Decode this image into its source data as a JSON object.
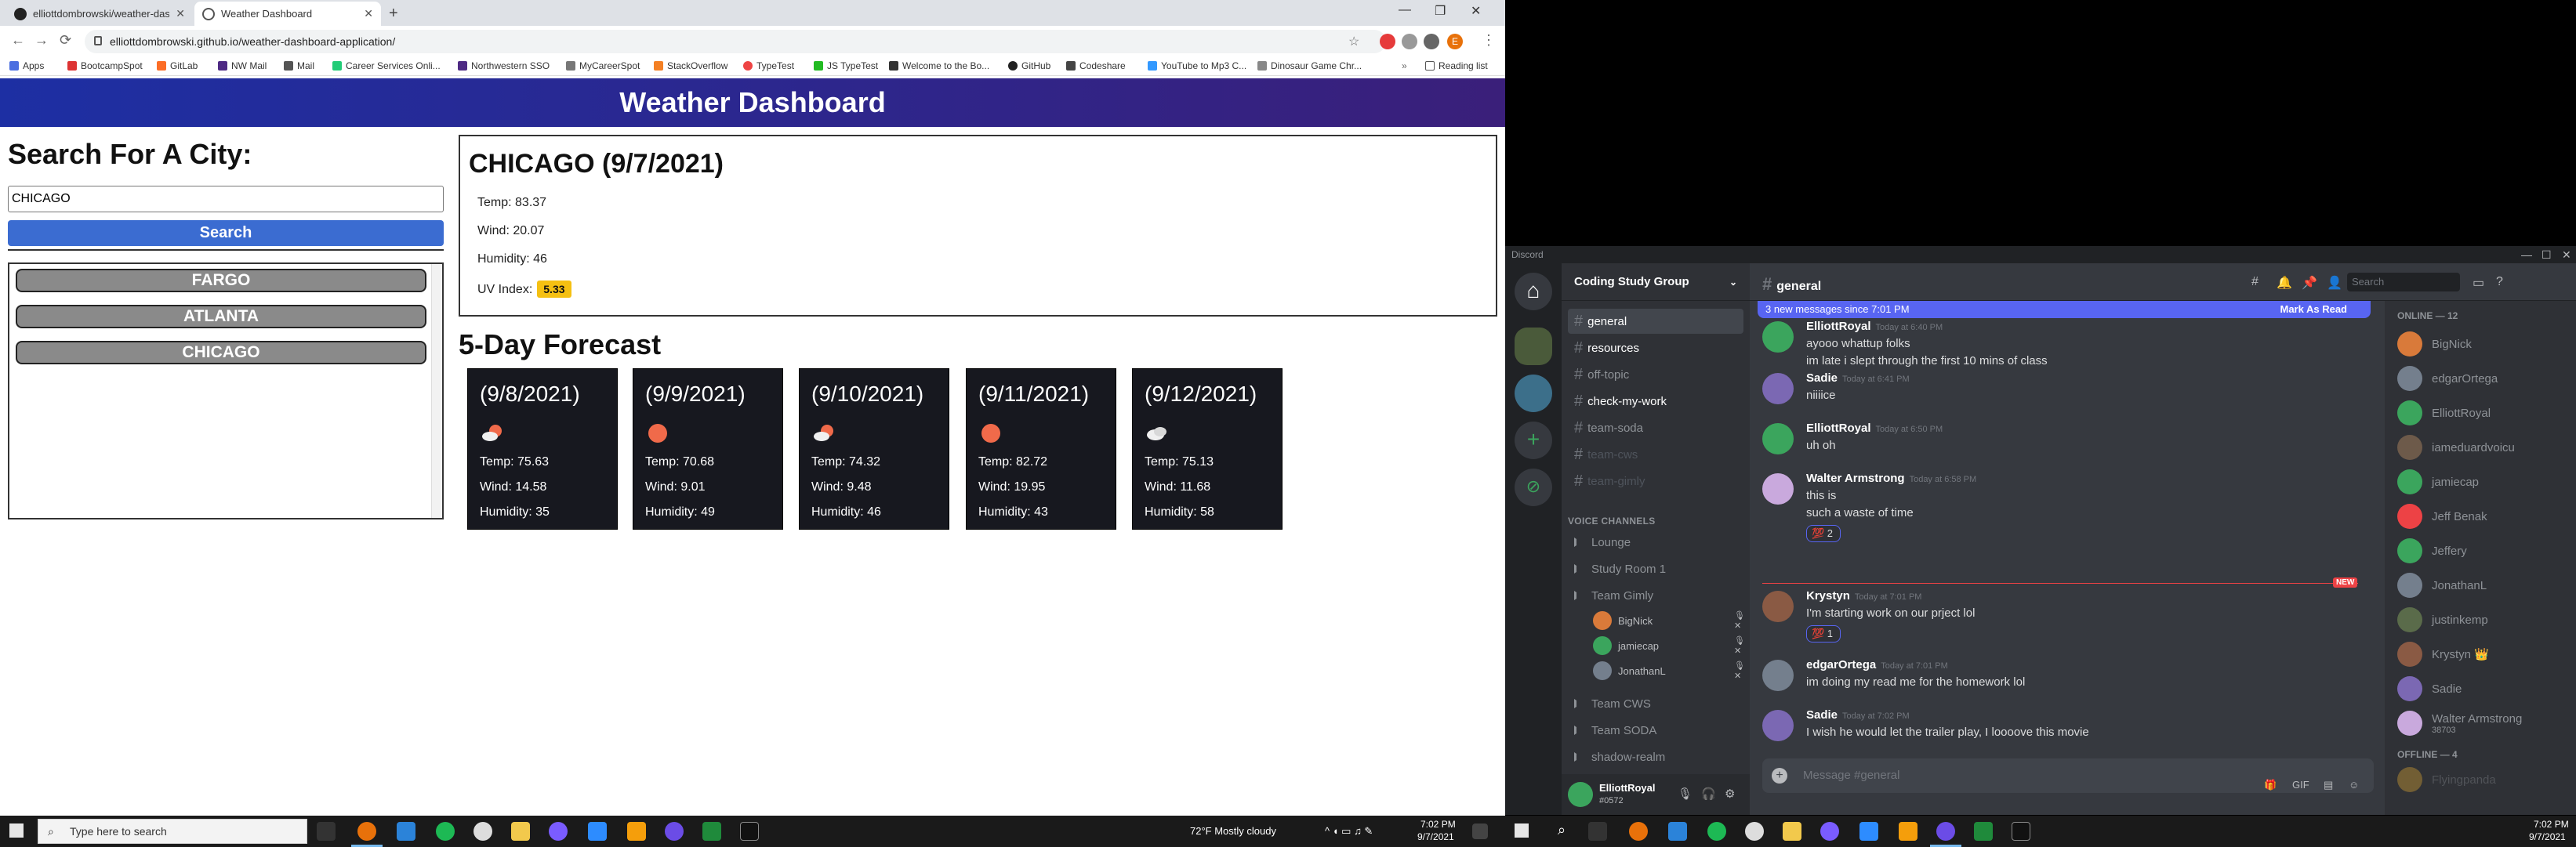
{
  "browser": {
    "tabs": [
      {
        "title": "elliottdombrowski/weather-dash"
      },
      {
        "title": "Weather Dashboard"
      }
    ],
    "url": "elliottdombrowski.github.io/weather-dashboard-application/",
    "profile_initial": "E",
    "bookmarks": [
      "Apps",
      "BootcampSpot",
      "GitLab",
      "NW Mail",
      "Mail",
      "Career Services Onli...",
      "Northwestern SSO",
      "MyCareerSpot",
      "StackOverflow",
      "TypeTest",
      "JS TypeTest",
      "Welcome to the Bo...",
      "GitHub",
      "Codeshare",
      "YouTube to Mp3 C...",
      "Dinosaur Game Chr...",
      "Reading list"
    ]
  },
  "weather": {
    "header": "Weather Dashboard",
    "search_heading": "Search For A City:",
    "input_value": "CHICAGO",
    "search_button": "Search",
    "history": [
      "FARGO",
      "ATLANTA",
      "CHICAGO"
    ],
    "current": {
      "title": "CHICAGO (9/7/2021)",
      "temp": "Temp: 83.37",
      "wind": "Wind: 20.07",
      "humidity": "Humidity: 46",
      "uv_label": "UV Index:",
      "uv_value": "5.33"
    },
    "forecast_heading": "5-Day Forecast",
    "forecast": [
      {
        "date": "(9/8/2021)",
        "icon": "sun-cloud-icon",
        "temp": "Temp: 75.63",
        "wind": "Wind: 14.58",
        "humidity": "Humidity: 35"
      },
      {
        "date": "(9/9/2021)",
        "icon": "sun-icon",
        "temp": "Temp: 70.68",
        "wind": "Wind: 9.01",
        "humidity": "Humidity: 49"
      },
      {
        "date": "(9/10/2021)",
        "icon": "sun-cloud-icon",
        "temp": "Temp: 74.32",
        "wind": "Wind: 9.48",
        "humidity": "Humidity: 46"
      },
      {
        "date": "(9/11/2021)",
        "icon": "sun-icon",
        "temp": "Temp: 82.72",
        "wind": "Wind: 19.95",
        "humidity": "Humidity: 43"
      },
      {
        "date": "(9/12/2021)",
        "icon": "cloud-icon",
        "temp": "Temp: 75.13",
        "wind": "Wind: 11.68",
        "humidity": "Humidity: 58"
      }
    ]
  },
  "discord": {
    "app_title": "Discord",
    "server_name": "Coding Study Group",
    "channel_name": "general",
    "text_channels": [
      {
        "name": "general",
        "state": "selected"
      },
      {
        "name": "resources",
        "state": "unread"
      },
      {
        "name": "off-topic",
        "state": "normal"
      },
      {
        "name": "check-my-work",
        "state": "unread"
      },
      {
        "name": "team-soda",
        "state": "normal"
      },
      {
        "name": "team-cws",
        "state": "muted"
      },
      {
        "name": "team-gimly",
        "state": "muted"
      }
    ],
    "voice_header": "VOICE CHANNELS",
    "voice_channels_a": [
      "Lounge",
      "Study Room 1",
      "Team Gimly"
    ],
    "voice_users": [
      "BigNick",
      "jamiecap",
      "JonathanL"
    ],
    "voice_channels_b": [
      "Team CWS",
      "Team SODA",
      "shadow-realm"
    ],
    "user": {
      "name": "ElliottRoyal",
      "tag": "#0572"
    },
    "search_placeholder": "Search",
    "new_messages_banner": "3 new messages since 7:01 PM",
    "mark_as_read": "Mark As Read",
    "messages": [
      {
        "author": "ElliottRoyal",
        "time": "Today at 6:40 PM",
        "lines": [
          "ayooo whattup folks",
          "im late i slept through the first 10 mins of class"
        ],
        "color": "#3ba55d"
      },
      {
        "author": "Sadie",
        "time": "Today at 6:41 PM",
        "lines": [
          "niiiice"
        ],
        "color": "#7b68b3"
      },
      {
        "author": "ElliottRoyal",
        "time": "Today at 6:50 PM",
        "lines": [
          "uh oh"
        ],
        "color": "#3ba55d"
      },
      {
        "author": "Walter Armstrong",
        "time": "Today at 6:58 PM",
        "lines": [
          "this is",
          "such a waste of time"
        ],
        "reaction": "💯 2",
        "color": "#c9a9dd"
      },
      {
        "author": "Krystyn",
        "time": "Today at 7:01 PM",
        "lines": [
          "I'm starting work on our prject lol"
        ],
        "reaction": "💯 1",
        "color": "#8a5a44"
      },
      {
        "author": "edgarOrtega",
        "time": "Today at 7:01 PM",
        "lines": [
          "im doing my read me for the homework lol"
        ],
        "color": "#747f8d"
      },
      {
        "author": "Sadie",
        "time": "Today at 7:02 PM",
        "lines": [
          "I wish he would let the trailer play, I loooove this movie"
        ],
        "color": "#7b68b3"
      }
    ],
    "new_label": "NEW",
    "composer_placeholder": "Message #general",
    "online_header": "ONLINE — 12",
    "members": [
      {
        "name": "BigNick",
        "color": "#d97a3a"
      },
      {
        "name": "edgarOrtega",
        "color": "#747f8d"
      },
      {
        "name": "ElliottRoyal",
        "color": "#3ba55d"
      },
      {
        "name": "iameduardvoicu",
        "color": "#6d5a4a"
      },
      {
        "name": "jamiecap",
        "color": "#3ba55d"
      },
      {
        "name": "Jeff Benak",
        "color": "#ed4245"
      },
      {
        "name": "Jeffery",
        "color": "#3ba55d"
      },
      {
        "name": "JonathanL",
        "color": "#747f8d"
      },
      {
        "name": "justinkemp",
        "color": "#5a6b4a"
      },
      {
        "name": "Krystyn 👑",
        "color": "#8a5a44"
      },
      {
        "name": "Sadie",
        "color": "#7b68b3"
      },
      {
        "name": "Walter Armstrong",
        "sub": "38703",
        "color": "#c9a9dd"
      }
    ],
    "offline_header": "OFFLINE — 4",
    "offline_members": [
      "Flyingpanda"
    ]
  },
  "taskbar_left": {
    "search": "Type here to search",
    "weather": "72°F  Mostly cloudy",
    "time": "7:02 PM",
    "date": "9/7/2021"
  },
  "taskbar_right": {
    "time": "7:02 PM",
    "date": "9/7/2021"
  }
}
